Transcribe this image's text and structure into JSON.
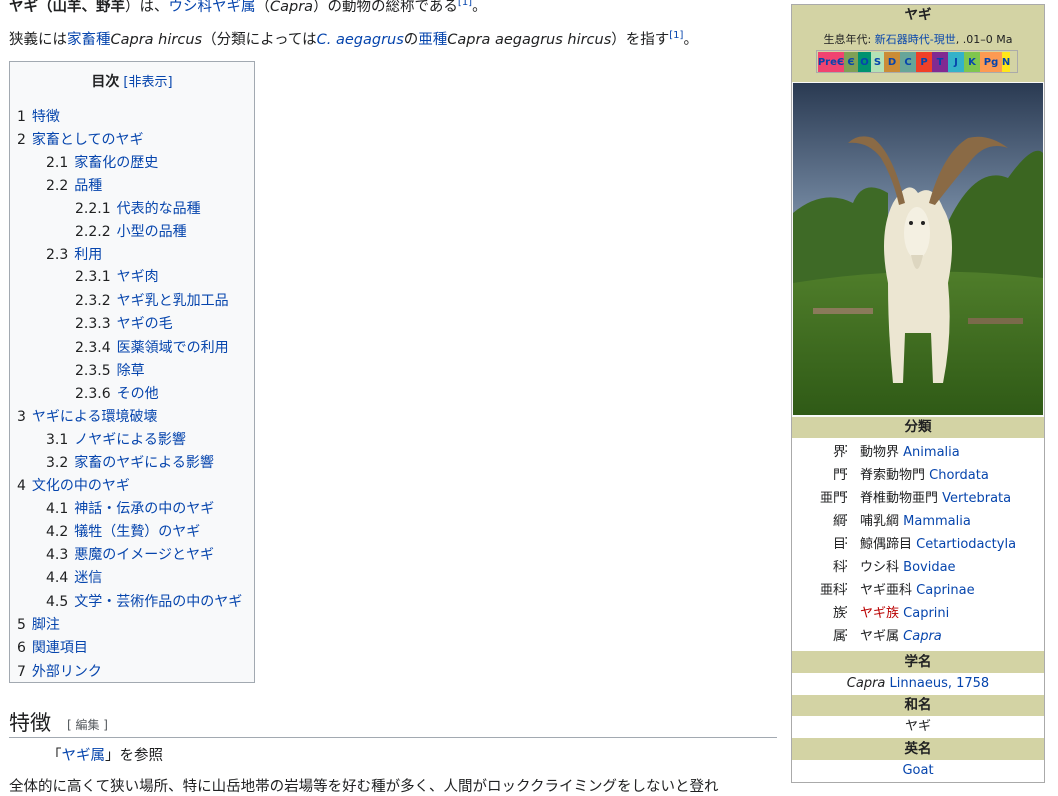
{
  "intro": {
    "p1_bold": "ヤギ",
    "p1_paren_open": "（",
    "p1_bold2": "山羊",
    "p1_sep": "、",
    "p1_bold3": "野羊",
    "p1_paren_close": "）は、",
    "p1_link": "ウシ科ヤギ属",
    "p1_genus_open": "（",
    "p1_genus": "Capra",
    "p1_end": "）の動物の総称である",
    "p1_ref": "[1]",
    "p1_period": "。",
    "p2_start": "狭義には",
    "p2_link1": "家畜種",
    "p2_sp1": "Capra hircus",
    "p2_mid": "（分類によっては",
    "p2_link2": "C. aegagrus",
    "p2_mid2": "の",
    "p2_link3": "亜種",
    "p2_sp2": "Capra aegagrus hircus",
    "p2_end": "）を指す",
    "p2_ref": "[1]",
    "p2_period": "。"
  },
  "toc": {
    "title": "目次",
    "toggle": "[非表示]",
    "items": [
      {
        "num": "1",
        "label": "特徴"
      },
      {
        "num": "2",
        "label": "家畜としてのヤギ"
      },
      {
        "num": "2.1",
        "label": "家畜化の歴史"
      },
      {
        "num": "2.2",
        "label": "品種"
      },
      {
        "num": "2.2.1",
        "label": "代表的な品種"
      },
      {
        "num": "2.2.2",
        "label": "小型の品種"
      },
      {
        "num": "2.3",
        "label": "利用"
      },
      {
        "num": "2.3.1",
        "label": "ヤギ肉"
      },
      {
        "num": "2.3.2",
        "label": "ヤギ乳と乳加工品"
      },
      {
        "num": "2.3.3",
        "label": "ヤギの毛"
      },
      {
        "num": "2.3.4",
        "label": "医薬領域での利用"
      },
      {
        "num": "2.3.5",
        "label": "除草"
      },
      {
        "num": "2.3.6",
        "label": "その他"
      },
      {
        "num": "3",
        "label": "ヤギによる環境破壊"
      },
      {
        "num": "3.1",
        "label": "ノヤギによる影響"
      },
      {
        "num": "3.2",
        "label": "家畜のヤギによる影響"
      },
      {
        "num": "4",
        "label": "文化の中のヤギ"
      },
      {
        "num": "4.1",
        "label": "神話・伝承の中のヤギ"
      },
      {
        "num": "4.2",
        "label": "犠牲（生贄）のヤギ"
      },
      {
        "num": "4.3",
        "label": "悪魔のイメージとヤギ"
      },
      {
        "num": "4.4",
        "label": "迷信"
      },
      {
        "num": "4.5",
        "label": "文学・芸術作品の中のヤギ"
      },
      {
        "num": "5",
        "label": "脚注"
      },
      {
        "num": "6",
        "label": "関連項目"
      },
      {
        "num": "7",
        "label": "外部リンク"
      }
    ]
  },
  "section": {
    "heading": "特徴",
    "edit": "[ 編集 ]",
    "hatnote_open": "「",
    "hatnote_link": "ヤギ属",
    "hatnote_close": "」を参照",
    "body": "全体的に高くて狭い場所、特に山岳地帯の岩場等を好む種が多く、人間がロッククライミングをしないと登れ"
  },
  "infobox": {
    "title": "ヤギ",
    "era_label": "生息年代:",
    "era_link": "新石器時代-現世",
    "era_range": ", .01–0 Ma",
    "geo_scale": [
      {
        "label": "PreЄ",
        "color": "#f04370"
      },
      {
        "label": "Є",
        "color": "#7fa056"
      },
      {
        "label": "O",
        "color": "#009270"
      },
      {
        "label": "S",
        "color": "#b3e1b6"
      },
      {
        "label": "D",
        "color": "#cb8c37"
      },
      {
        "label": "C",
        "color": "#67a599"
      },
      {
        "label": "P",
        "color": "#f04028"
      },
      {
        "label": "T",
        "color": "#812b92"
      },
      {
        "label": "J",
        "color": "#34b2c9"
      },
      {
        "label": "K",
        "color": "#7fc64e"
      },
      {
        "label": "Pg",
        "color": "#fd9a52"
      },
      {
        "label": "N",
        "color": "#ffe619"
      }
    ],
    "classification_head": "分類",
    "taxonomy": [
      {
        "rank": "界",
        "ja": "動物界",
        "la": "Animalia",
        "red": false
      },
      {
        "rank": "門",
        "ja": "脊索動物門",
        "la": "Chordata",
        "red": false
      },
      {
        "rank": "亜門",
        "ja": "脊椎動物亜門",
        "la": "Vertebrata",
        "red": false
      },
      {
        "rank": "綱",
        "ja": "哺乳綱",
        "la": "Mammalia",
        "red": false
      },
      {
        "rank": "目",
        "ja": "鯨偶蹄目",
        "la": "Cetartiodactyla",
        "red": false
      },
      {
        "rank": "科",
        "ja": "ウシ科",
        "la": "Bovidae",
        "red": false
      },
      {
        "rank": "亜科",
        "ja": "ヤギ亜科",
        "la": "Caprinae",
        "red": false
      },
      {
        "rank": "族",
        "ja": "ヤギ族",
        "la": "Caprini",
        "red": true
      },
      {
        "rank": "属",
        "ja": "ヤギ属",
        "la": "Capra",
        "red": false,
        "italic": true
      }
    ],
    "sci_head": "学名",
    "sci_genus": "Capra",
    "sci_author": "Linnaeus, 1758",
    "ja_head": "和名",
    "ja_name": "ヤギ",
    "en_head": "英名",
    "en_name": "Goat"
  }
}
